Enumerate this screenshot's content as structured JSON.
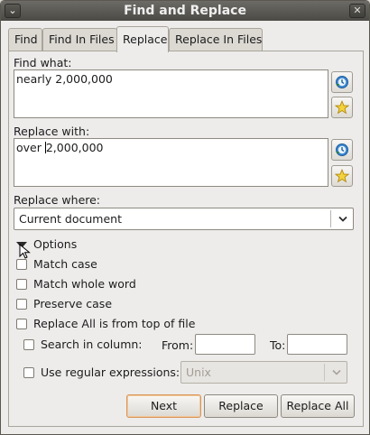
{
  "window": {
    "title": "Find and Replace",
    "menu_glyph": "⌄",
    "close_glyph": "✕"
  },
  "tabs": [
    {
      "label": "Find",
      "active": false
    },
    {
      "label": "Find In Files",
      "active": false
    },
    {
      "label": "Replace",
      "active": true
    },
    {
      "label": "Replace In Files",
      "active": false
    }
  ],
  "find": {
    "label": "Find what:",
    "value": "nearly 2,000,000",
    "history_icon": "history-icon",
    "favorite_icon": "star-icon"
  },
  "replace": {
    "label": "Replace with:",
    "value_before_caret": "over ",
    "value_after_caret": "2,000,000",
    "history_icon": "history-icon",
    "favorite_icon": "star-icon"
  },
  "where": {
    "label": "Replace where:",
    "selected": "Current document"
  },
  "options": {
    "label": "Options",
    "expanded": true,
    "match_case": {
      "label": "Match case",
      "checked": false
    },
    "whole_word": {
      "label": "Match whole word",
      "checked": false
    },
    "preserve_case": {
      "label": "Preserve case",
      "checked": false
    },
    "from_top": {
      "label": "Replace All is from top of file",
      "checked": false
    },
    "search_column": {
      "label": "Search in column:",
      "checked": false
    },
    "from_label": "From:",
    "from_value": "",
    "to_label": "To:",
    "to_value": "",
    "regex": {
      "label": "Use regular expressions:",
      "checked": false
    },
    "regex_type": "Unix"
  },
  "buttons": {
    "next": "Next",
    "replace": "Replace",
    "replace_all": "Replace All"
  }
}
